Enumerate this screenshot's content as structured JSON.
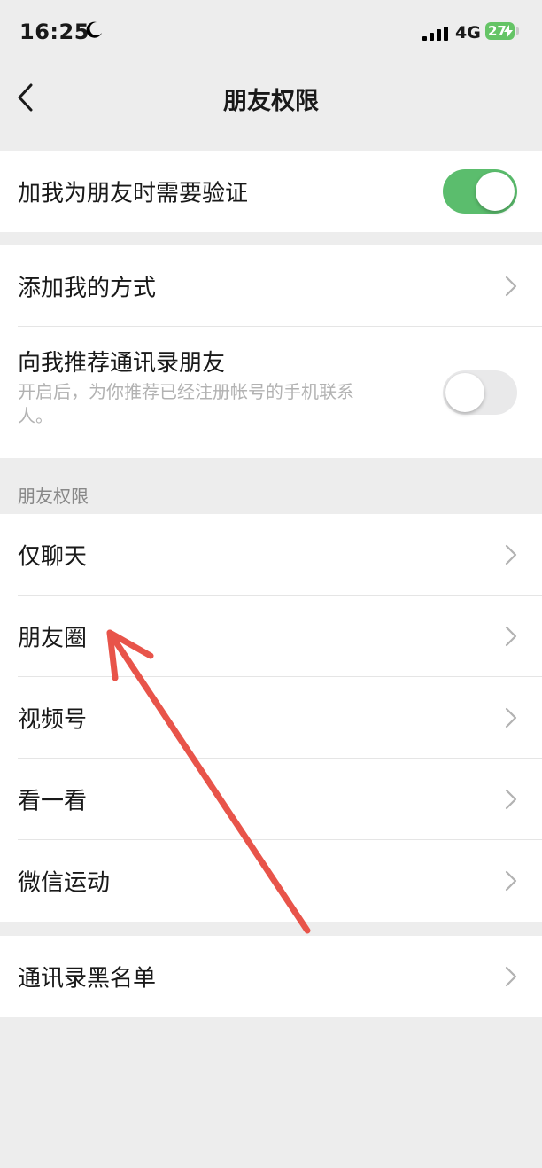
{
  "status_bar": {
    "time": "16:25",
    "network": "4G",
    "battery": "27",
    "icons": [
      "moon-icon",
      "signal-icon",
      "battery-charging-icon"
    ]
  },
  "nav": {
    "title": "朋友权限",
    "back_icon": "chevron-left-icon"
  },
  "group1": {
    "verify_label": "加我为朋友时需要验证",
    "verify_toggle": "on"
  },
  "group2": {
    "add_methods_label": "添加我的方式",
    "recommend_title": "向我推荐通讯录朋友",
    "recommend_desc": "开启后，为你推荐已经注册帐号的手机联系人。",
    "recommend_toggle": "off"
  },
  "section_header": "朋友权限",
  "permissions": {
    "items": [
      {
        "label": "仅聊天"
      },
      {
        "label": "朋友圈"
      },
      {
        "label": "视频号"
      },
      {
        "label": "看一看"
      },
      {
        "label": "微信运动"
      }
    ]
  },
  "blacklist": {
    "label": "通讯录黑名单"
  },
  "colors": {
    "background": "#ededed",
    "toggle_on": "#5bbd6d",
    "annotation_arrow": "#e8544a"
  }
}
